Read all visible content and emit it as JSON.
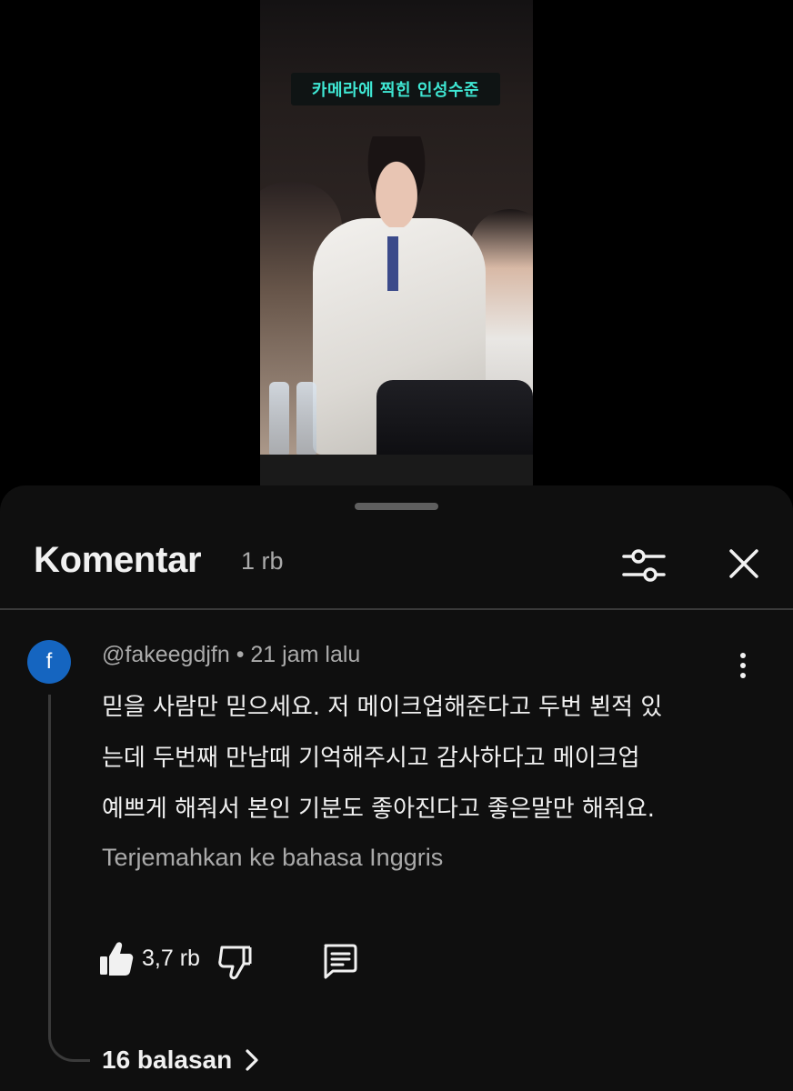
{
  "video": {
    "caption": "카메라에 찍힌 인성수준"
  },
  "comments_panel": {
    "title": "Komentar",
    "count": "1 rb",
    "filter_icon": "sliders-icon",
    "close_icon": "close-icon"
  },
  "comment": {
    "avatar_letter": "f",
    "avatar_color": "#1565c0",
    "author": "@fakeegdjfn",
    "separator": " • ",
    "time": "21 jam lalu",
    "text_lines": [
      "믿을 사람만 믿으세요. 저 메이크업해준다고 두번 뵌적 있",
      "는데 두번째 만남때 기억해주시고 감사하다고 메이크업",
      "예쁘게 해줘서 본인 기분도 좋아진다고 좋은말만 해줘요."
    ],
    "translate_label": "Terjemahkan ke bahasa Inggris",
    "like_count": "3,7 rb",
    "replies_label": "16 balasan"
  }
}
